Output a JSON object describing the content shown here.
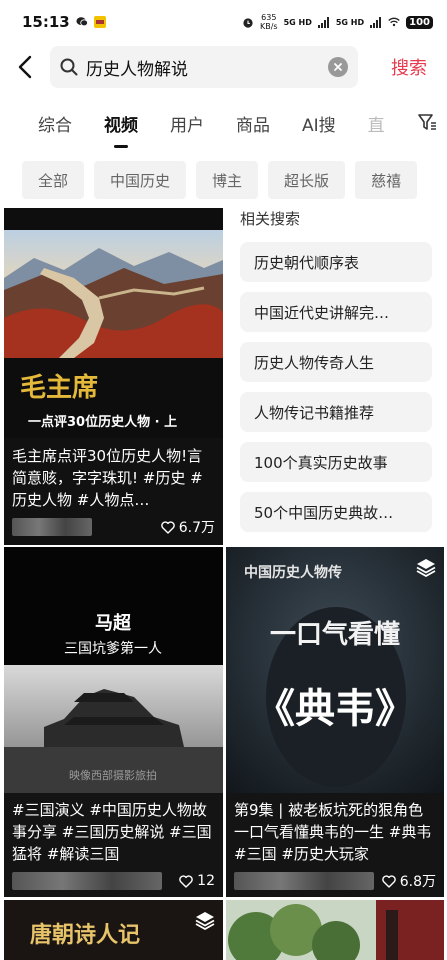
{
  "status_bar": {
    "time": "15:13",
    "net_speed_value": "635",
    "net_speed_unit": "KB/s",
    "signal_1": "5G HD",
    "signal_2": "5G HD",
    "battery": "100"
  },
  "search": {
    "query": "历史人物解说",
    "submit_label": "搜索"
  },
  "tabs": [
    {
      "label": "综合",
      "active": false
    },
    {
      "label": "视频",
      "active": true
    },
    {
      "label": "用户",
      "active": false
    },
    {
      "label": "商品",
      "active": false
    },
    {
      "label": "AI搜",
      "active": false
    },
    {
      "label": "直",
      "active": false
    }
  ],
  "chips": [
    "全部",
    "中国历史",
    "博主",
    "超长版",
    "慈禧"
  ],
  "related": {
    "title": "相关搜索",
    "items": [
      "历史朝代顺序表",
      "中国近代史讲解完…",
      "历史人物传奇人生",
      "人物传记书籍推荐",
      "100个真实历史故事",
      "50个中国历史典故…"
    ]
  },
  "videos": [
    {
      "cover_big_text": "毛主席",
      "cover_sub_text": "一点评30位历史人物 · 上",
      "desc": "毛主席点评30位历史人物!言简意赅，字字珠玑! #历史 #历史人物 #人物点…",
      "likes": "6.7万"
    },
    {
      "cover_title": "马超",
      "cover_subtitle": "三国坑爹第一人",
      "cover_watermark": "映像西部摄影旅拍",
      "desc": "#三国演义 #中国历史人物故事分享 #三国历史解说 #三国猛将 #解读三国",
      "likes": "12"
    },
    {
      "cover_top_text": "中国历史人物传",
      "cover_mid_text": "一口气看懂",
      "cover_big_text": "《典韦》",
      "desc": "第9集 | 被老板坑死的狠角色 一口气看懂典韦的一生 #典韦 #三国 #历史大玩家",
      "likes": "6.8万"
    },
    {
      "cover_title": "唐朝诗人记"
    },
    {}
  ]
}
